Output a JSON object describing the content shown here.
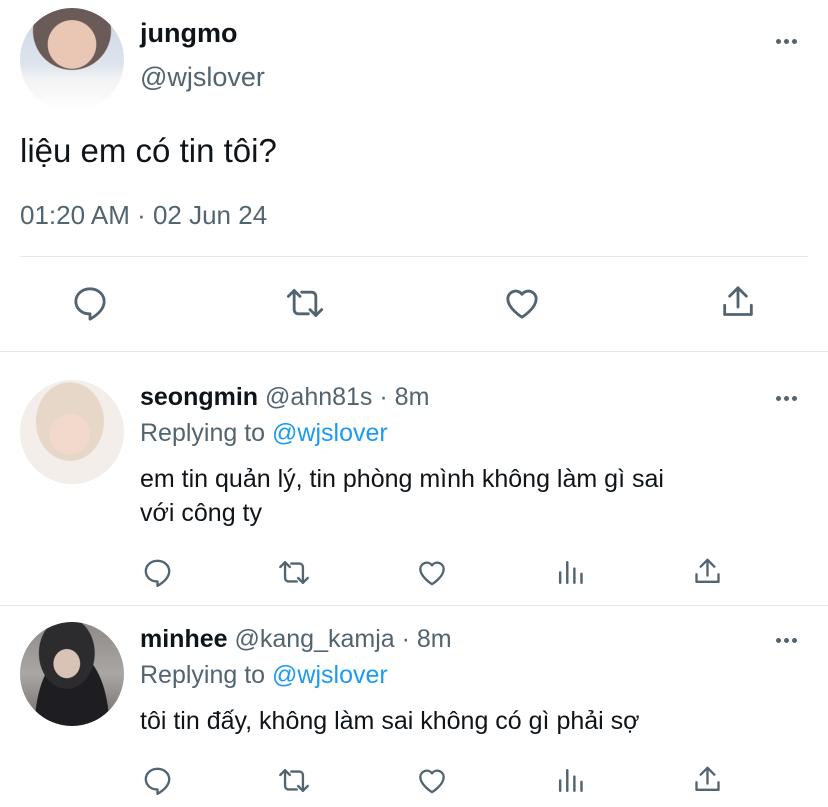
{
  "main_tweet": {
    "display_name": "jungmo",
    "handle": "@wjslover",
    "text": "liệu em có tin tôi?",
    "timestamp": "01:20 AM · 02 Jun 24"
  },
  "replies": [
    {
      "display_name": "seongmin",
      "handle": "@ahn81s",
      "time": "· 8m",
      "replying_label": "Replying to",
      "replying_to": "@wjslover",
      "text_line1": "em tin quản lý, tin phòng mình không làm gì sai",
      "text_line2": "với công ty"
    },
    {
      "display_name": "minhee",
      "handle": "@kang_kamja",
      "time": "· 8m",
      "replying_label": "Replying to",
      "replying_to": "@wjslover",
      "text_line1": "tôi tin đấy, không làm sai không có gì phải sợ"
    }
  ],
  "icons": [
    "more-icon",
    "reply-icon",
    "retweet-icon",
    "like-icon",
    "analytics-icon",
    "share-icon"
  ],
  "colors": {
    "link": "#1d9bf0",
    "secondary_text": "#536471",
    "divider": "#e6e9eb",
    "icon": "#536471"
  }
}
